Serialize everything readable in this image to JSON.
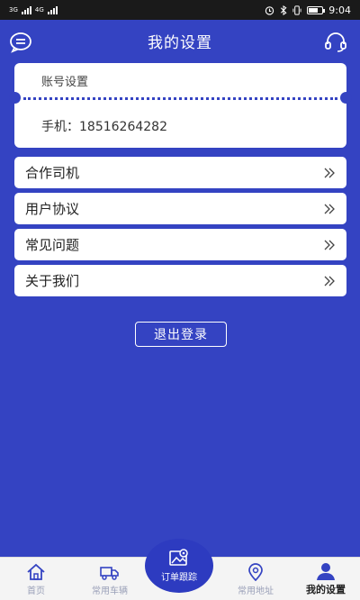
{
  "status_bar": {
    "network_1": "3G",
    "network_2": "4G",
    "time": "9:04"
  },
  "header": {
    "title": "我的设置",
    "left_icon": "message-icon",
    "right_icon": "headset-icon"
  },
  "account": {
    "title": "账号设置",
    "phone_label": "手机：",
    "phone_value": "18516264282"
  },
  "menu": {
    "items": [
      {
        "label": "合作司机"
      },
      {
        "label": "用户协议"
      },
      {
        "label": "常见问题"
      },
      {
        "label": "关于我们"
      }
    ]
  },
  "logout_label": "退出登录",
  "tabbar": {
    "home": "首页",
    "vehicles": "常用车辆",
    "order_tracking": "订单跟踪",
    "addresses": "常用地址",
    "settings": "我的设置"
  },
  "colors": {
    "background": "#3443c2",
    "accent": "#2d3bc0",
    "card": "#ffffff"
  }
}
